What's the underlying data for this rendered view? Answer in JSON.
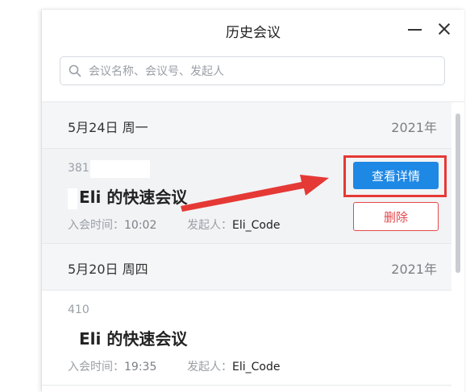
{
  "window": {
    "title": "历史会议",
    "minimize_icon": "minimize-icon",
    "close_icon": "close-icon"
  },
  "search": {
    "placeholder": "会议名称、会议号、发起人",
    "value": "",
    "icon": "search-icon"
  },
  "groups": [
    {
      "date": "5月24日 周一",
      "year": "2021年",
      "meetings": [
        {
          "id": "381",
          "title_user": "Eli",
          "title_suffix": "的快速会议",
          "join_label": "入会时间：",
          "join_time": "10:02",
          "host_label": "发起人：",
          "host": "Eli_Code",
          "detail_button": "查看详情",
          "delete_button": "删除",
          "selected": true
        }
      ]
    },
    {
      "date": "5月20日 周四",
      "year": "2021年",
      "meetings": [
        {
          "id": "410",
          "title_user": "Eli",
          "title_suffix": "的快速会议",
          "join_label": "入会时间：",
          "join_time": "19:35",
          "host_label": "发起人：",
          "host": "Eli_Code"
        }
      ]
    }
  ],
  "annotation": {
    "highlight_color": "#e53935",
    "arrow_color": "#e53935"
  },
  "colors": {
    "accent": "#1e88e5",
    "danger": "#e5484d",
    "selected_bg": "#f2f3f5",
    "header_bg": "#f5f6f7"
  }
}
